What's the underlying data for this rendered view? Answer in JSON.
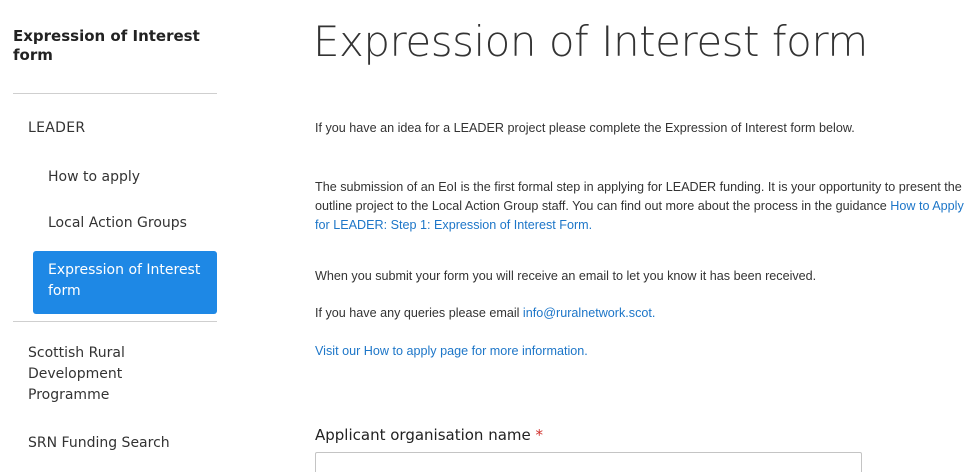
{
  "sidebar": {
    "title": "Expression of Interest form",
    "section": "LEADER",
    "items": [
      {
        "label": "How to apply"
      },
      {
        "label": "Local Action Groups"
      },
      {
        "label": "Expression of Interest form"
      }
    ],
    "other_items": [
      {
        "label": "Scottish Rural Development Programme"
      },
      {
        "label": "SRN Funding Search"
      }
    ]
  },
  "main": {
    "title": "Expression of Interest form",
    "p1": "If you have an idea for a LEADER project please complete the Expression of Interest form below.",
    "p2_text": "The submission of an EoI is the first formal step in applying for LEADER funding. It is your opportunity to present the outline project to the Local Action Group staff. You can find out more about the process in the guidance ",
    "p2_link": "How to Apply for LEADER: Step 1: Expression of Interest Form.",
    "p3": "When you submit your form you will receive an email to let you know it has been received.",
    "p4_text": "If you have any queries please email ",
    "p4_link": "info@ruralnetwork.scot.",
    "p5_link": "Visit our How to apply page for more information.",
    "form": {
      "org_label": "Applicant organisation name",
      "required_marker": "*",
      "org_value": ""
    }
  }
}
